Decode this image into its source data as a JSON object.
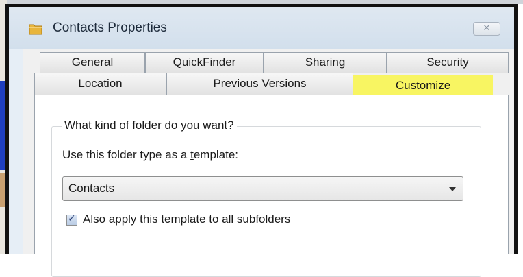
{
  "dialog": {
    "title": "Contacts Properties",
    "close_glyph": "✕",
    "title_icon": "folder-icon"
  },
  "tabs": {
    "row1": [
      {
        "label": "General"
      },
      {
        "label": "QuickFinder"
      },
      {
        "label": "Sharing"
      },
      {
        "label": "Security"
      }
    ],
    "row2": [
      {
        "label": "Location"
      },
      {
        "label": "Previous Versions"
      },
      {
        "label": "Customize",
        "active": true
      }
    ]
  },
  "panel": {
    "group_legend": "What kind of folder do you want?",
    "use_template_label_pre": "Use this folder type as a ",
    "use_template_label_ul": "t",
    "use_template_label_post": "emplate:",
    "folder_type_value": "Contacts",
    "apply_subfolders_checked": true,
    "apply_label_pre": "Also apply this template to all ",
    "apply_label_ul": "s",
    "apply_label_post": "ubfolders"
  },
  "colors": {
    "highlight": "#f8f562",
    "frame": "#111111",
    "titlebar": "#dfe8f1"
  }
}
